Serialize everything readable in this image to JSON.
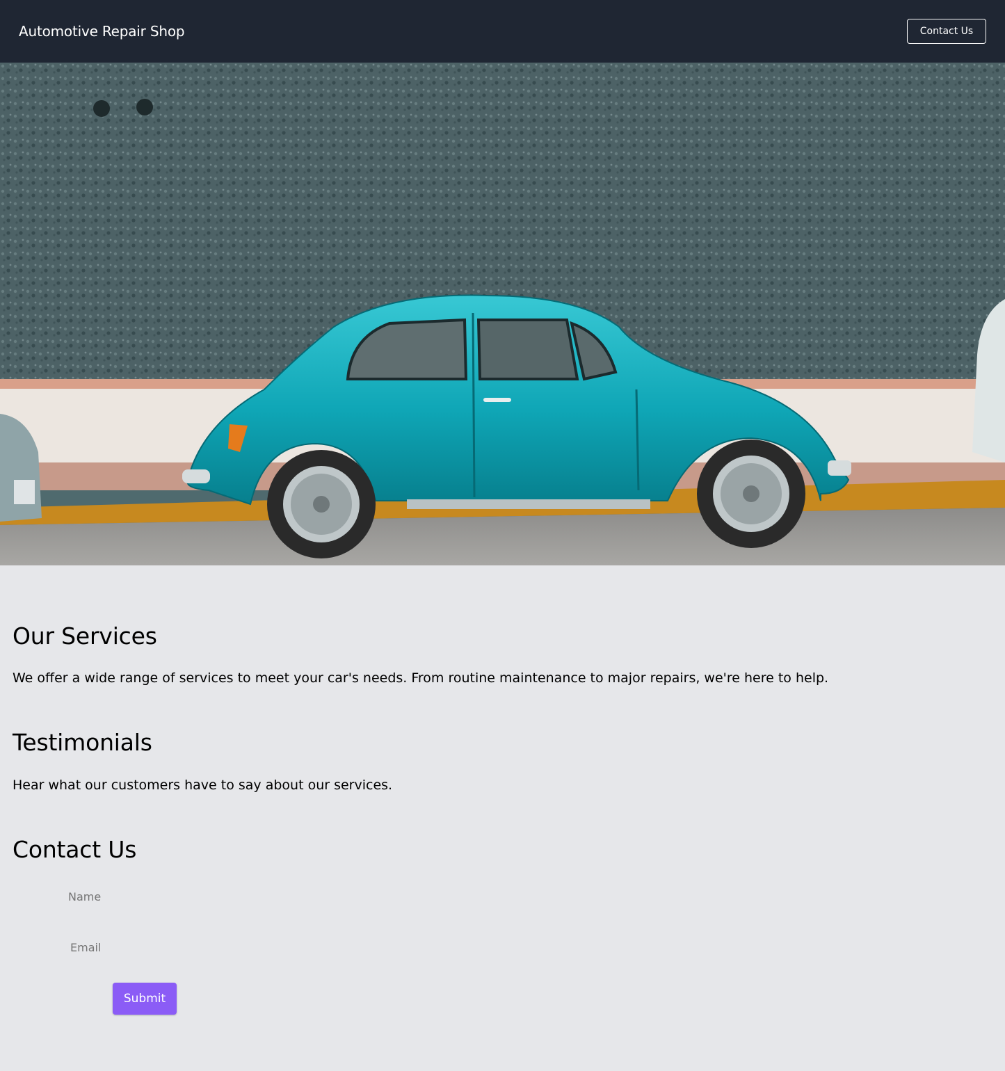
{
  "header": {
    "brand": "Automotive Repair Shop",
    "contact_button": "Contact Us"
  },
  "hero": {
    "image": "teal-beetle-car-photo"
  },
  "services": {
    "title": "Our Services",
    "text": "We offer a wide range of services to meet your car's needs. From routine maintenance to major repairs, we're here to help."
  },
  "testimonials": {
    "title": "Testimonials",
    "text": "Hear what our customers have to say about our services."
  },
  "contact": {
    "title": "Contact Us",
    "name_placeholder": "Name",
    "email_placeholder": "Email",
    "submit_label": "Submit"
  },
  "colors": {
    "header_bg": "#1f2633",
    "page_bg": "#e6e7ea",
    "accent": "#8b5cf6"
  }
}
